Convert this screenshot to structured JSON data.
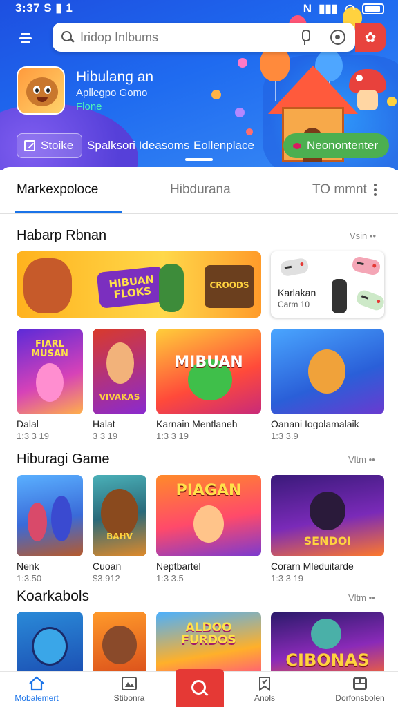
{
  "status": {
    "time": "3:37",
    "carrier_icons": "S ▮ 1",
    "network": "N"
  },
  "search": {
    "placeholder": "Iridop Inlbums"
  },
  "featured": {
    "title": "Hibulang an",
    "subtitle": "Apllegpo Gomo",
    "tag": "Flone"
  },
  "chips": [
    "Stoike",
    "Spalksori Ideasoms",
    "Eollenplace",
    "Neonontenter"
  ],
  "tabs": [
    {
      "label": "Markexpoloce",
      "active": true
    },
    {
      "label": "Hibdurana",
      "active": false
    },
    {
      "label": "TO mmnt",
      "active": false
    }
  ],
  "sections": [
    {
      "title": "Habarp Rbnan",
      "link": "Vsin ••",
      "banner": {
        "logo": "HIBUAN FLOKS",
        "badge": "CROODS"
      },
      "controller_card": {
        "title": "Karlakan",
        "subtitle": "Carm 10"
      },
      "tiles": [
        {
          "name": "Dalal",
          "price": "1:3 3 19",
          "logo": "FIARL MUSAN"
        },
        {
          "name": "Halat",
          "price": "3 3 19",
          "logo": "VIVAKAS"
        },
        {
          "name": "Karnain Mentlaneh",
          "price": "1:3 3 19",
          "logo": "MIBUAN"
        },
        {
          "name": "Oanani Iogolamalaik",
          "price": "1:3 3.9",
          "logo": ""
        }
      ]
    },
    {
      "title": "Hiburagi Game",
      "link": "Vltm ••",
      "tiles": [
        {
          "name": "Nenk",
          "price": "1:3.50",
          "logo": ""
        },
        {
          "name": "Cuoan",
          "price": "$3.912",
          "logo": "BAHV"
        },
        {
          "name": "Neptbartel",
          "price": "1:3 3.5",
          "logo": "PIAGAN"
        },
        {
          "name": "Corarn Mleduitarde",
          "price": "1:3 3 19",
          "logo": "SENDOI"
        }
      ]
    },
    {
      "title": "Koarkabols",
      "link": "Vltm ••",
      "tiles": [
        {
          "name": "",
          "price": "",
          "logo": ""
        },
        {
          "name": "",
          "price": "",
          "logo": ""
        },
        {
          "name": "",
          "price": "",
          "logo": "ALDOO FURDOS"
        },
        {
          "name": "",
          "price": "",
          "logo": "CIBONAS"
        }
      ]
    }
  ],
  "bottom_nav": [
    {
      "label": "Mobalemert",
      "icon": "home-icon",
      "active": true
    },
    {
      "label": "Stibonra",
      "icon": "library-icon",
      "active": false
    },
    {
      "label": "",
      "icon": "search-icon",
      "active": false
    },
    {
      "label": "Anols",
      "icon": "bookmark-icon",
      "active": false
    },
    {
      "label": "Dorfonsbolen",
      "icon": "grid-icon",
      "active": false
    }
  ],
  "colors": {
    "accent": "#1a73e8",
    "hero": "#1f5fe8",
    "danger": "#e53935",
    "chip_green": "#4caf50"
  }
}
